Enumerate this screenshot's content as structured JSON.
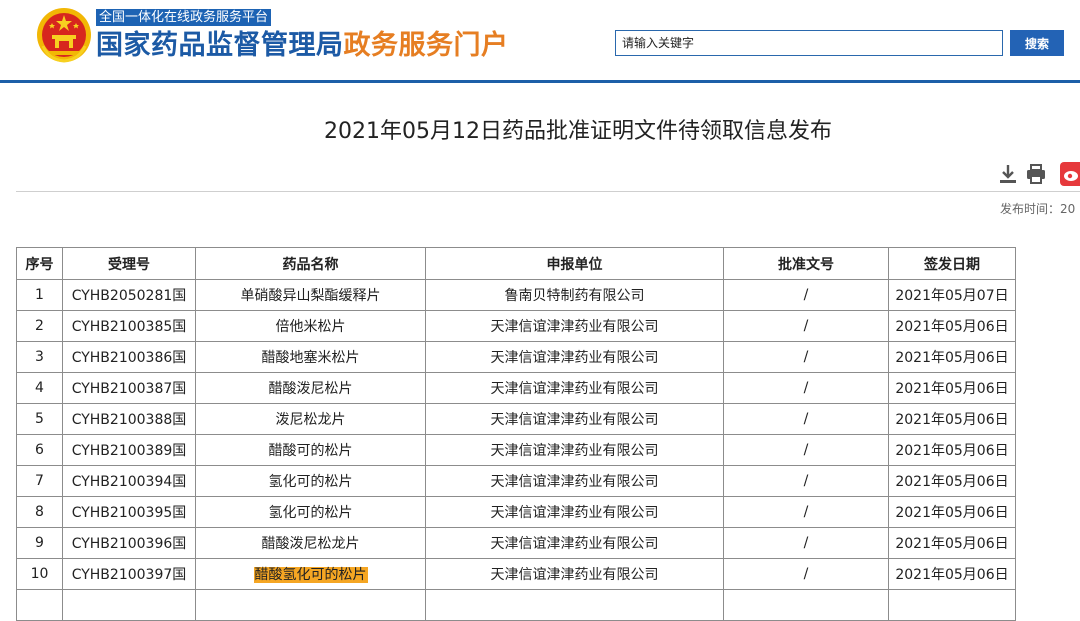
{
  "header": {
    "subtitle": "全国一体化在线政务服务平台",
    "title_main": "国家药品监督管理局",
    "title_accent": "政务服务门户",
    "brand_color": "#1c5aa5",
    "accent_color": "#e67e22",
    "emblem_icon": "national-emblem-icon"
  },
  "search": {
    "placeholder": "请输入关键字",
    "button_label": "搜索"
  },
  "article": {
    "title": "2021年05月12日药品批准证明文件待领取信息发布",
    "publish_time": "发布时间：20",
    "tools": [
      "download-icon",
      "print-icon",
      "weibo-share-icon"
    ]
  },
  "table": {
    "headers": [
      "序号",
      "受理号",
      "药品名称",
      "申报单位",
      "批准文号",
      "签发日期"
    ],
    "rows": [
      [
        "1",
        "CYHB2050281国",
        "单硝酸异山梨酯缓释片",
        "鲁南贝特制药有限公司",
        "/",
        "2021年05月07日"
      ],
      [
        "2",
        "CYHB2100385国",
        "倍他米松片",
        "天津信谊津津药业有限公司",
        "/",
        "2021年05月06日"
      ],
      [
        "3",
        "CYHB2100386国",
        "醋酸地塞米松片",
        "天津信谊津津药业有限公司",
        "/",
        "2021年05月06日"
      ],
      [
        "4",
        "CYHB2100387国",
        "醋酸泼尼松片",
        "天津信谊津津药业有限公司",
        "/",
        "2021年05月06日"
      ],
      [
        "5",
        "CYHB2100388国",
        "泼尼松龙片",
        "天津信谊津津药业有限公司",
        "/",
        "2021年05月06日"
      ],
      [
        "6",
        "CYHB2100389国",
        "醋酸可的松片",
        "天津信谊津津药业有限公司",
        "/",
        "2021年05月06日"
      ],
      [
        "7",
        "CYHB2100394国",
        "氢化可的松片",
        "天津信谊津津药业有限公司",
        "/",
        "2021年05月06日"
      ],
      [
        "8",
        "CYHB2100395国",
        "氢化可的松片",
        "天津信谊津津药业有限公司",
        "/",
        "2021年05月06日"
      ],
      [
        "9",
        "CYHB2100396国",
        "醋酸泼尼松龙片",
        "天津信谊津津药业有限公司",
        "/",
        "2021年05月06日"
      ],
      [
        "10",
        "CYHB2100397国",
        "醋酸氢化可的松片",
        "天津信谊津津药业有限公司",
        "/",
        "2021年05月06日"
      ]
    ],
    "highlighted_cell": {
      "row": 10,
      "column": "药品名称",
      "color": "#f5a623"
    }
  }
}
